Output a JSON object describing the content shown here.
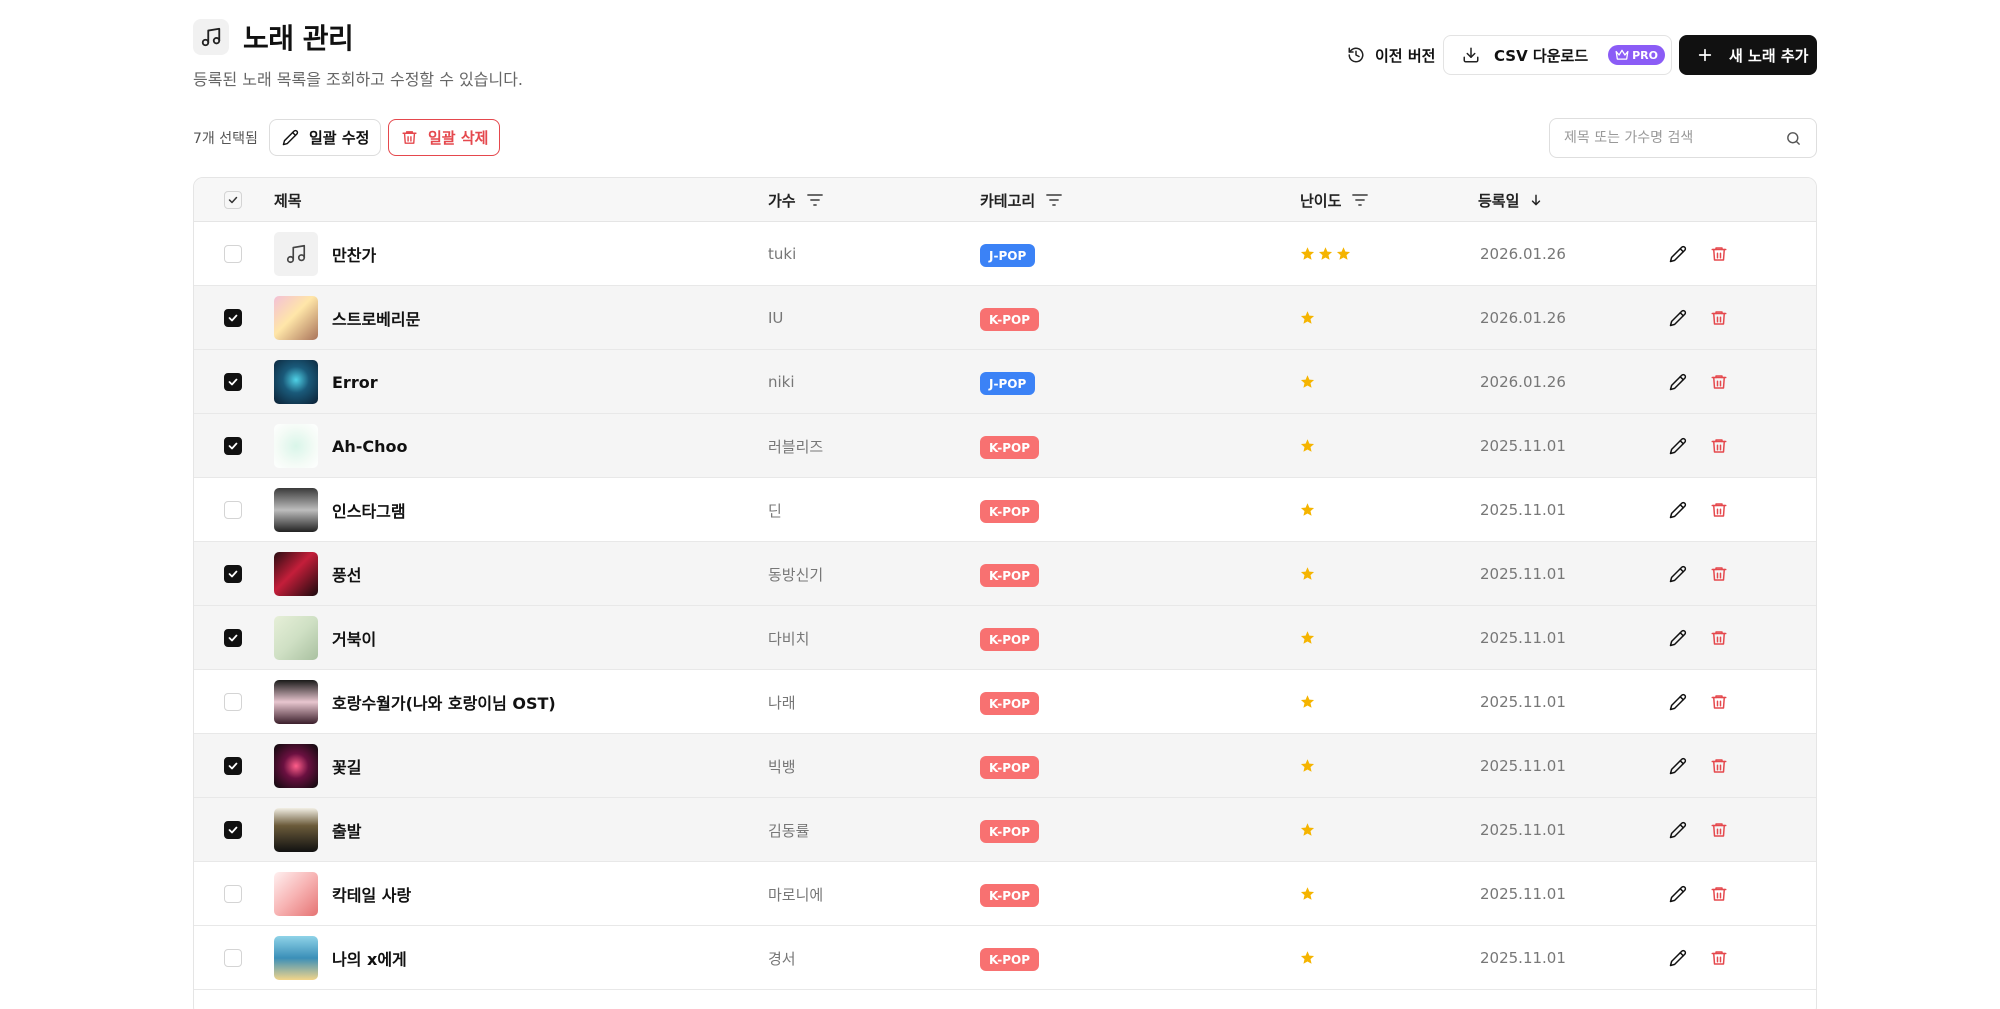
{
  "header": {
    "title": "노래 관리",
    "subtitle": "등록된 노래 목록을 조회하고 수정할 수 있습니다.",
    "prev_version_label": "이전 버전",
    "csv_label": "CSV 다운로드",
    "pro_label": "PRO",
    "add_label": "새 노래 추가"
  },
  "toolbar": {
    "selected_count": "7개 선택됨",
    "bulk_edit_label": "일괄 수정",
    "bulk_delete_label": "일괄 삭제",
    "search_placeholder": "제목 또는 가수명 검색"
  },
  "table": {
    "columns": {
      "title": "제목",
      "artist": "가수",
      "category": "카테고리",
      "difficulty": "난이도",
      "date": "등록일"
    },
    "rows": [
      {
        "title": "만찬가",
        "artist": "tuki",
        "category": "J-POP",
        "difficulty": 3,
        "date": "2026.01.26",
        "selected": false,
        "thumb": "music-note-icon"
      },
      {
        "title": "스트로베리문",
        "artist": "IU",
        "category": "K-POP",
        "difficulty": 1,
        "date": "2026.01.26",
        "selected": true,
        "thumb": "album-cover"
      },
      {
        "title": "Error",
        "artist": "niki",
        "category": "J-POP",
        "difficulty": 1,
        "date": "2026.01.26",
        "selected": true,
        "thumb": "album-cover"
      },
      {
        "title": "Ah-Choo",
        "artist": "러블리즈",
        "category": "K-POP",
        "difficulty": 1,
        "date": "2025.11.01",
        "selected": true,
        "thumb": "album-cover"
      },
      {
        "title": "인스타그램",
        "artist": "딘",
        "category": "K-POP",
        "difficulty": 1,
        "date": "2025.11.01",
        "selected": false,
        "thumb": "album-cover"
      },
      {
        "title": "풍선",
        "artist": "동방신기",
        "category": "K-POP",
        "difficulty": 1,
        "date": "2025.11.01",
        "selected": true,
        "thumb": "album-cover"
      },
      {
        "title": "거북이",
        "artist": "다비치",
        "category": "K-POP",
        "difficulty": 1,
        "date": "2025.11.01",
        "selected": true,
        "thumb": "album-cover"
      },
      {
        "title": "호랑수월가(나와 호랑이님 OST)",
        "artist": "나래",
        "category": "K-POP",
        "difficulty": 1,
        "date": "2025.11.01",
        "selected": false,
        "thumb": "album-cover"
      },
      {
        "title": "꽃길",
        "artist": "빅뱅",
        "category": "K-POP",
        "difficulty": 1,
        "date": "2025.11.01",
        "selected": true,
        "thumb": "album-cover"
      },
      {
        "title": "출발",
        "artist": "김동률",
        "category": "K-POP",
        "difficulty": 1,
        "date": "2025.11.01",
        "selected": true,
        "thumb": "album-cover"
      },
      {
        "title": "칵테일 사랑",
        "artist": "마로니에",
        "category": "K-POP",
        "difficulty": 1,
        "date": "2025.11.01",
        "selected": false,
        "thumb": "album-cover"
      },
      {
        "title": "나의 x에게",
        "artist": "경서",
        "category": "K-POP",
        "difficulty": 1,
        "date": "2025.11.01",
        "selected": false,
        "thumb": "album-cover"
      }
    ]
  },
  "colors": {
    "jpop": "#3b82f6",
    "kpop": "#f87171",
    "star": "#f5b400",
    "danger": "#e5484d",
    "pro": "#8b5cf6"
  }
}
